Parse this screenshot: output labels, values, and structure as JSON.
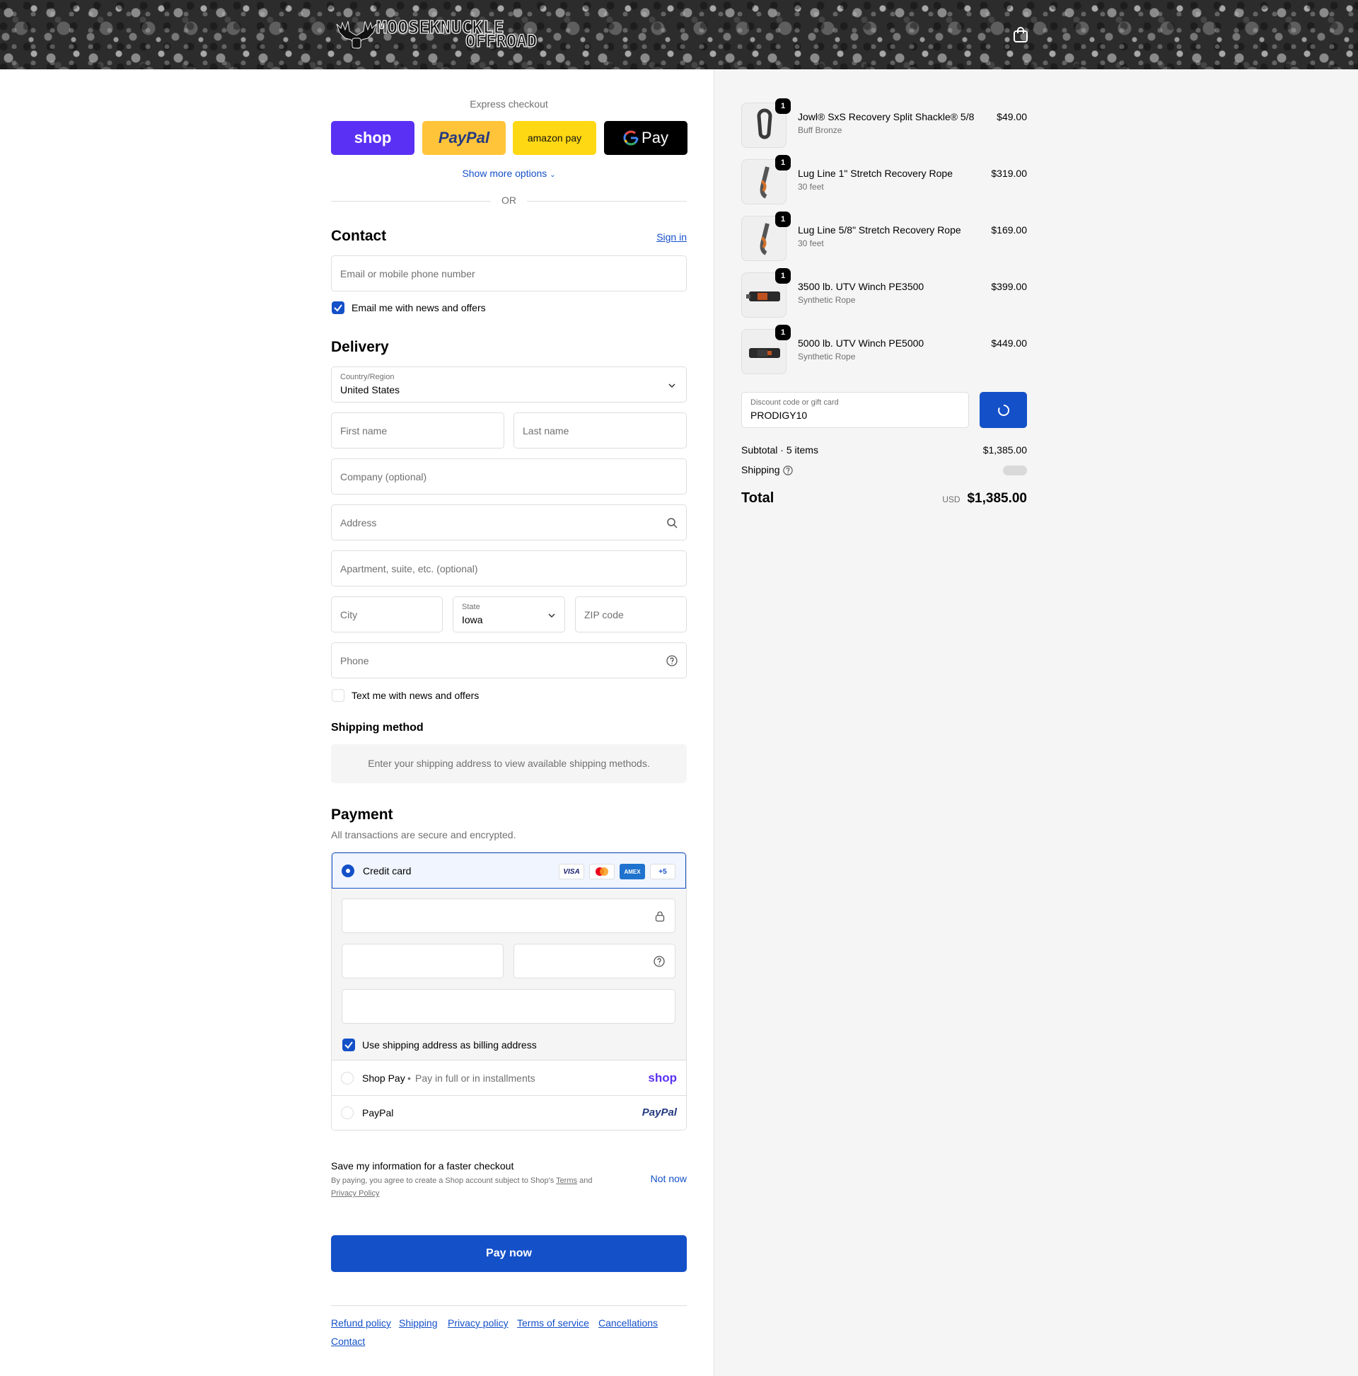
{
  "header": {
    "logo_line1": "MOOSEKNUCKLE",
    "logo_line2": "OFFROAD"
  },
  "express": {
    "title": "Express checkout",
    "buttons": [
      "shop",
      "PayPal",
      "amazon pay",
      "Pay"
    ],
    "show_more": "Show more options",
    "or": "OR"
  },
  "contact": {
    "title": "Contact",
    "sign_in": "Sign in",
    "email_placeholder": "Email or mobile phone number",
    "email_optin": "Email me with news and offers"
  },
  "delivery": {
    "title": "Delivery",
    "country_label": "Country/Region",
    "country_value": "United States",
    "first_name": "First name",
    "last_name": "Last name",
    "company": "Company (optional)",
    "address": "Address",
    "apartment": "Apartment, suite, etc. (optional)",
    "city": "City",
    "state_label": "State",
    "state_value": "Iowa",
    "zip": "ZIP code",
    "phone": "Phone",
    "text_optin": "Text me with news and offers"
  },
  "shipping_method": {
    "title": "Shipping method",
    "message": "Enter your shipping address to view available shipping methods."
  },
  "payment": {
    "title": "Payment",
    "subtitle": "All transactions are secure and encrypted.",
    "credit_card": "Credit card",
    "brands": [
      "VISA",
      "AMEX",
      "+5"
    ],
    "billing_same": "Use shipping address as billing address",
    "shop_pay": "Shop Pay",
    "shop_pay_sub": "Pay in full or in installments",
    "shop_pay_logo": "shop",
    "paypal": "PayPal",
    "paypal_logo": "PayPal"
  },
  "save_info": {
    "title": "Save my information for a faster checkout",
    "legal_prefix": "By paying, you agree to create a Shop account subject to Shop's",
    "terms": "Terms",
    "and": "and",
    "privacy": "Privacy Policy",
    "not_now": "Not now"
  },
  "pay_now": "Pay now",
  "footer_links": [
    "Refund policy",
    "Shipping",
    "Privacy policy",
    "Terms of service",
    "Cancellations",
    "Contact"
  ],
  "order": {
    "items": [
      {
        "name": "Jowl® SxS Recovery Split Shackle® 5/8",
        "variant": "Buff Bronze",
        "price": "$49.00",
        "qty": "1"
      },
      {
        "name": "Lug Line 1\" Stretch Recovery Rope",
        "variant": "30 feet",
        "price": "$319.00",
        "qty": "1"
      },
      {
        "name": "Lug Line 5/8\" Stretch Recovery Rope",
        "variant": "30 feet",
        "price": "$169.00",
        "qty": "1"
      },
      {
        "name": "3500 lb. UTV Winch PE3500",
        "variant": "Synthetic Rope",
        "price": "$399.00",
        "qty": "1"
      },
      {
        "name": "5000 lb. UTV Winch PE5000",
        "variant": "Synthetic Rope",
        "price": "$449.00",
        "qty": "1"
      }
    ],
    "discount_label": "Discount code or gift card",
    "discount_value": "PRODIGY10",
    "subtotal_label": "Subtotal · 5 items",
    "subtotal_value": "$1,385.00",
    "shipping_label": "Shipping",
    "total_label": "Total",
    "currency": "USD",
    "total_value": "$1,385.00"
  },
  "colors": {
    "accent": "#1450c8",
    "shop_purple": "#5a31f4",
    "paypal_yellow": "#ffc439",
    "amazon_yellow": "#ffd814"
  }
}
